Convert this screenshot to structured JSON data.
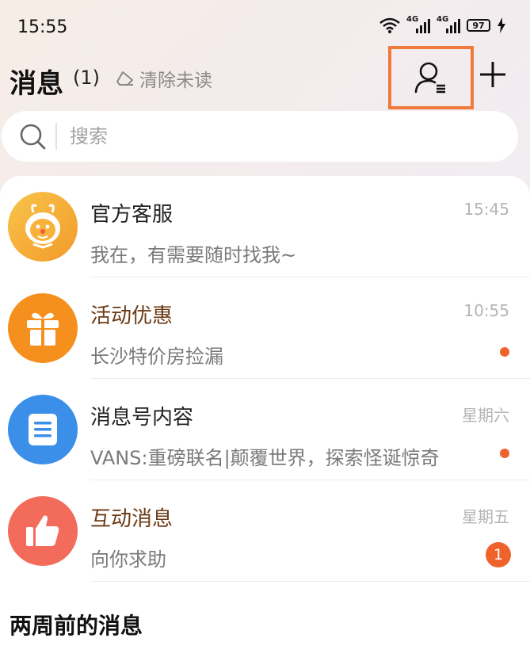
{
  "status_bar": {
    "time": "15:55",
    "network_1": "4G",
    "network_2": "4G",
    "battery": "97"
  },
  "header": {
    "title": "消息",
    "count": "(1)",
    "clear_label": "清除未读"
  },
  "search": {
    "placeholder": "搜索"
  },
  "messages": [
    {
      "name": "官方客服",
      "preview": "我在，有需要随时找我~",
      "time": "15:45",
      "avatar_color": "#f5a623",
      "icon": "mascot-icon"
    },
    {
      "name": "活动优惠",
      "preview": "长沙特价房捡漏",
      "time": "10:55",
      "avatar_color": "#f5901e",
      "icon": "gift-icon",
      "unread_dot": true
    },
    {
      "name": "消息号内容",
      "preview": "VANS:重磅联名|颠覆世界，探索怪诞惊奇",
      "time": "星期六",
      "avatar_color": "#3b8fe8",
      "icon": "document-icon",
      "unread_dot": true
    },
    {
      "name": "互动消息",
      "preview": "向你求助",
      "time": "星期五",
      "avatar_color": "#f26b5b",
      "icon": "thumbs-up-icon",
      "badge": "1"
    }
  ],
  "section": {
    "older_title": "两周前的消息"
  },
  "colors": {
    "accent_orange": "#f07a3c",
    "unread": "#f0622b",
    "brown_name": "#6b3a14"
  }
}
